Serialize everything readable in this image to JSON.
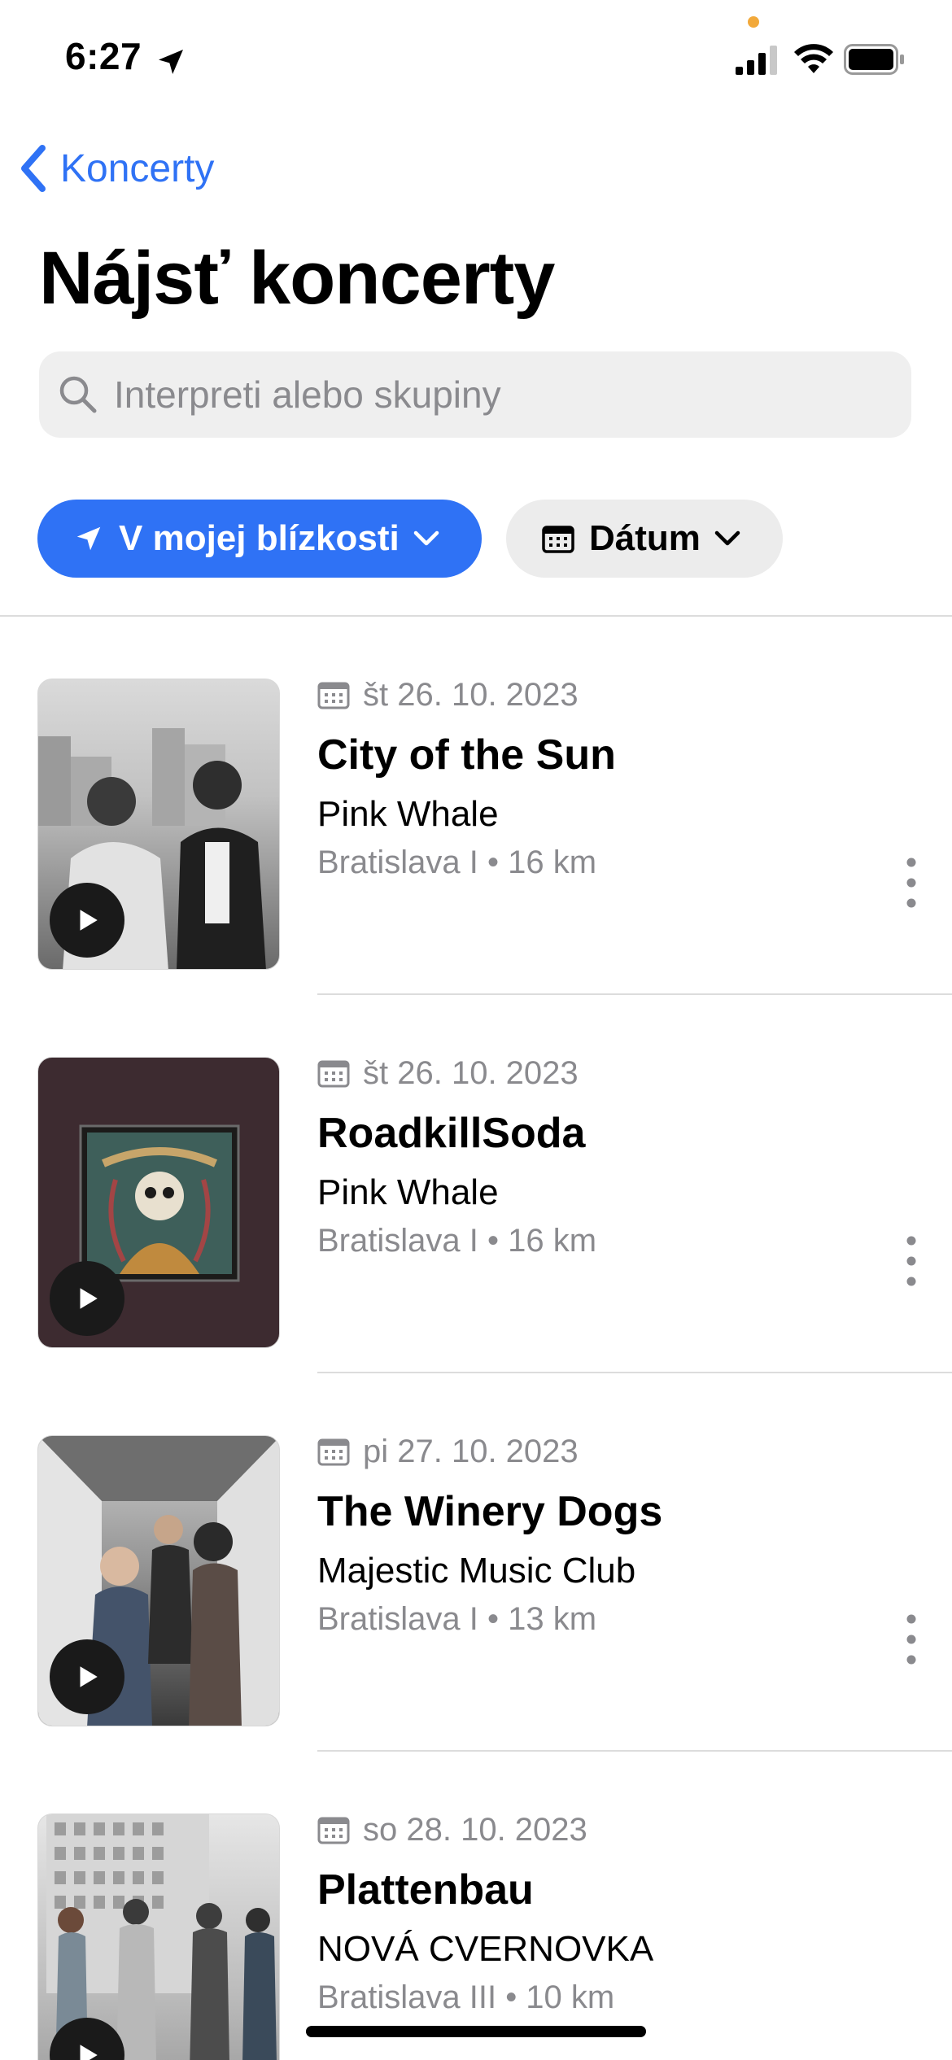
{
  "status_bar": {
    "time": "6:27",
    "indicator_color": "#f2a93b"
  },
  "nav": {
    "back_label": "Koncerty"
  },
  "page": {
    "title": "Nájsť koncerty"
  },
  "search": {
    "placeholder": "Interpreti alebo skupiny",
    "value": ""
  },
  "filters": {
    "near": {
      "label": "V mojej blízkosti",
      "icon": "location-arrow-icon",
      "color": "#2f72f5"
    },
    "date": {
      "label": "Dátum",
      "icon": "calendar-icon"
    }
  },
  "concerts": [
    {
      "date": "št 26. 10. 2023",
      "band": "City of the Sun",
      "venue": "Pink Whale",
      "place": "Bratislava I • 16 km"
    },
    {
      "date": "št 26. 10. 2023",
      "band": "RoadkillSoda",
      "venue": "Pink Whale",
      "place": "Bratislava I • 16 km"
    },
    {
      "date": "pi 27. 10. 2023",
      "band": "The Winery Dogs",
      "venue": "Majestic Music Club",
      "place": "Bratislava I • 13 km"
    },
    {
      "date": "so 28. 10. 2023",
      "band": "Plattenbau",
      "venue": "NOVÁ CVERNOVKA",
      "place": "Bratislava III • 10 km"
    }
  ]
}
